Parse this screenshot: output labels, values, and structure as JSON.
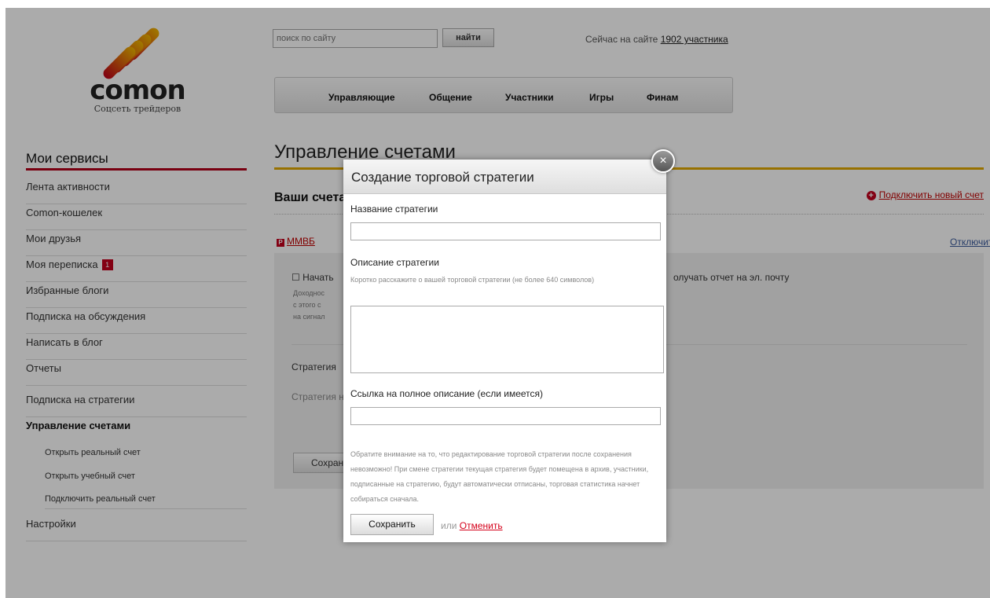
{
  "logo": {
    "word": "comon",
    "subtitle": "Соцсеть трейдеров"
  },
  "search": {
    "placeholder": "поиск по сайту",
    "button": "найти"
  },
  "online": {
    "prefix": "Сейчас на сайте",
    "count_link": "1902 участника"
  },
  "topnav": [
    "Управляющие",
    "Общение",
    "Участники",
    "Игры",
    "Финам"
  ],
  "sidebar": {
    "title": "Мои сервисы",
    "items": [
      {
        "label": "Лента активности"
      },
      {
        "label": "Comon-кошелек"
      },
      {
        "label": "Мои друзья"
      },
      {
        "label": "Моя переписка",
        "badge": "1"
      },
      {
        "label": "Избранные блоги"
      },
      {
        "label": "Подписка на обсуждения"
      },
      {
        "label": "Написать в блог"
      },
      {
        "label": "Отчеты"
      },
      {
        "label": "Подписка на стратегии"
      },
      {
        "label": "Управление счетами"
      }
    ],
    "subitems": [
      "Открыть реальный счет",
      "Открыть учебный счет",
      "Подключить реальный счет"
    ],
    "settings": "Настройки"
  },
  "main": {
    "title": "Управление счетами",
    "accounts_title": "Ваши счета",
    "connect_link": "Подключить новый счет",
    "account_name": "ММВБ",
    "disconnect": "Отключить",
    "checkbox_label": "Начать",
    "small_lines": [
      "Доходнос",
      "с этого с",
      "на сигнал"
    ],
    "email_text": "олучать отчет на эл. почту",
    "strategy_label": "Стратегия",
    "strategy_hint": "Стратегия н",
    "save_button": "Сохран"
  },
  "modal": {
    "title": "Создание торговой стратегии",
    "name_label": "Название стратегии",
    "desc_label": "Описание стратегии",
    "desc_hint": "Коротко расскажите о вашей торговой стратегии (не более 640 символов)",
    "link_label": "Ссылка на полное описание (если имеется)",
    "note": "Обратите внимание на то, что редактирование торговой стратегии после сохранения невозможно! При смене стратегии текущая стратегия будет помещена в архив, участники, подписанные на стратегию, будут автоматически отписаны, торговая статистика начнет собираться сначала.",
    "save": "Сохранить",
    "or": "или",
    "cancel": "Отменить",
    "close": "×"
  }
}
